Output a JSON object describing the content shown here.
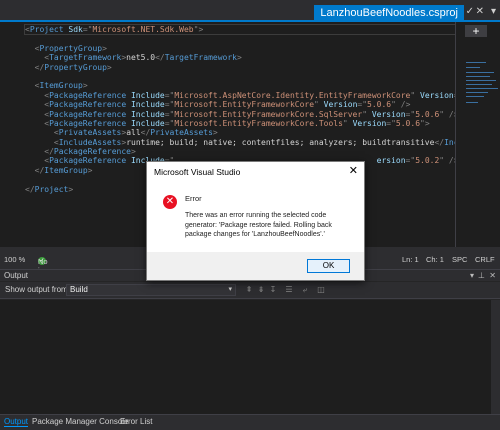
{
  "tabs": {
    "active_label": "LanzhouBeefNoodles.csproj",
    "pin_icon": "pin-icon",
    "close_icon": "close-icon",
    "dropdown_icon": "chevron-down-icon"
  },
  "editor": {
    "lines": [
      {
        "parts": [
          [
            "b",
            "<"
          ],
          [
            "t",
            "Project"
          ],
          [
            "x",
            " "
          ],
          [
            "a",
            "Sdk"
          ],
          [
            "b",
            "=\""
          ],
          [
            "v",
            "Microsoft.NET.Sdk.Web"
          ],
          [
            "b",
            "\">"
          ]
        ]
      },
      {
        "parts": []
      },
      {
        "parts": [
          [
            "x",
            "  "
          ],
          [
            "b",
            "<"
          ],
          [
            "t",
            "PropertyGroup"
          ],
          [
            "b",
            ">"
          ]
        ]
      },
      {
        "parts": [
          [
            "x",
            "    "
          ],
          [
            "b",
            "<"
          ],
          [
            "t",
            "TargetFramework"
          ],
          [
            "b",
            ">"
          ],
          [
            "x",
            "net5.0"
          ],
          [
            "b",
            "</"
          ],
          [
            "t",
            "TargetFramework"
          ],
          [
            "b",
            ">"
          ]
        ]
      },
      {
        "parts": [
          [
            "x",
            "  "
          ],
          [
            "b",
            "</"
          ],
          [
            "t",
            "PropertyGroup"
          ],
          [
            "b",
            ">"
          ]
        ]
      },
      {
        "parts": []
      },
      {
        "parts": [
          [
            "x",
            "  "
          ],
          [
            "b",
            "<"
          ],
          [
            "t",
            "ItemGroup"
          ],
          [
            "b",
            ">"
          ]
        ]
      },
      {
        "parts": [
          [
            "x",
            "    "
          ],
          [
            "b",
            "<"
          ],
          [
            "t",
            "PackageReference"
          ],
          [
            "x",
            " "
          ],
          [
            "a",
            "Include"
          ],
          [
            "b",
            "=\""
          ],
          [
            "v",
            "Microsoft.AspNetCore.Identity.EntityFrameworkCore"
          ],
          [
            "b",
            "\" "
          ],
          [
            "a",
            "Version"
          ],
          [
            "b",
            "=\""
          ],
          [
            "v",
            "5.0.6"
          ],
          [
            "b",
            "\" />"
          ]
        ]
      },
      {
        "parts": [
          [
            "x",
            "    "
          ],
          [
            "b",
            "<"
          ],
          [
            "t",
            "PackageReference"
          ],
          [
            "x",
            " "
          ],
          [
            "a",
            "Include"
          ],
          [
            "b",
            "=\""
          ],
          [
            "v",
            "Microsoft.EntityFrameworkCore"
          ],
          [
            "b",
            "\" "
          ],
          [
            "a",
            "Version"
          ],
          [
            "b",
            "=\""
          ],
          [
            "v",
            "5.0.6"
          ],
          [
            "b",
            "\" />"
          ]
        ]
      },
      {
        "parts": [
          [
            "x",
            "    "
          ],
          [
            "b",
            "<"
          ],
          [
            "t",
            "PackageReference"
          ],
          [
            "x",
            " "
          ],
          [
            "a",
            "Include"
          ],
          [
            "b",
            "=\""
          ],
          [
            "v",
            "Microsoft.EntityFrameworkCore.SqlServer"
          ],
          [
            "b",
            "\" "
          ],
          [
            "a",
            "Version"
          ],
          [
            "b",
            "=\""
          ],
          [
            "v",
            "5.0.6"
          ],
          [
            "b",
            "\" />"
          ]
        ]
      },
      {
        "parts": [
          [
            "x",
            "    "
          ],
          [
            "b",
            "<"
          ],
          [
            "t",
            "PackageReference"
          ],
          [
            "x",
            " "
          ],
          [
            "a",
            "Include"
          ],
          [
            "b",
            "=\""
          ],
          [
            "v",
            "Microsoft.EntityFrameworkCore.Tools"
          ],
          [
            "b",
            "\" "
          ],
          [
            "a",
            "Version"
          ],
          [
            "b",
            "=\""
          ],
          [
            "v",
            "5.0.6"
          ],
          [
            "b",
            "\">"
          ]
        ]
      },
      {
        "parts": [
          [
            "x",
            "      "
          ],
          [
            "b",
            "<"
          ],
          [
            "t",
            "PrivateAssets"
          ],
          [
            "b",
            ">"
          ],
          [
            "x",
            "all"
          ],
          [
            "b",
            "</"
          ],
          [
            "t",
            "PrivateAssets"
          ],
          [
            "b",
            ">"
          ]
        ]
      },
      {
        "parts": [
          [
            "x",
            "      "
          ],
          [
            "b",
            "<"
          ],
          [
            "t",
            "IncludeAssets"
          ],
          [
            "b",
            ">"
          ],
          [
            "x",
            "runtime; build; native; contentfiles; analyzers; buildtransitive"
          ],
          [
            "b",
            "</"
          ],
          [
            "t",
            "IncludeAssets"
          ],
          [
            "b",
            ">"
          ]
        ]
      },
      {
        "parts": [
          [
            "x",
            "    "
          ],
          [
            "b",
            "</"
          ],
          [
            "t",
            "PackageReference"
          ],
          [
            "b",
            ">"
          ]
        ]
      },
      {
        "parts": [
          [
            "x",
            "    "
          ],
          [
            "b",
            "<"
          ],
          [
            "t",
            "PackageReference"
          ],
          [
            "x",
            " "
          ],
          [
            "a",
            "Include"
          ],
          [
            "b",
            "=\""
          ],
          [
            "v",
            "                                          "
          ],
          [
            "a",
            "ersion"
          ],
          [
            "b",
            "=\""
          ],
          [
            "v",
            "5.0.2"
          ],
          [
            "b",
            "\" />"
          ]
        ]
      },
      {
        "parts": [
          [
            "x",
            "  "
          ],
          [
            "b",
            "</"
          ],
          [
            "t",
            "ItemGroup"
          ],
          [
            "b",
            ">"
          ]
        ]
      },
      {
        "parts": []
      },
      {
        "parts": [
          [
            "b",
            "</"
          ],
          [
            "t",
            "Project"
          ],
          [
            "b",
            ">"
          ]
        ]
      }
    ]
  },
  "status": {
    "zoom": "100 %",
    "issues": "No issues found",
    "line": "Ln: 1",
    "col": "Ch: 1",
    "spacing": "SPC",
    "eol": "CRLF"
  },
  "output": {
    "title": "Output",
    "show_from_label": "Show output from:",
    "selected": "Build"
  },
  "bottom_tabs": [
    "Output",
    "Package Manager Console",
    "Error List"
  ],
  "dialog": {
    "title": "Microsoft Visual Studio",
    "heading": "Error",
    "message": "There was an error running the selected code generator: 'Package restore failed. Rolling back package changes for 'LanzhouBeefNoodles'.'",
    "ok_label": "OK",
    "icon": "error-icon"
  }
}
